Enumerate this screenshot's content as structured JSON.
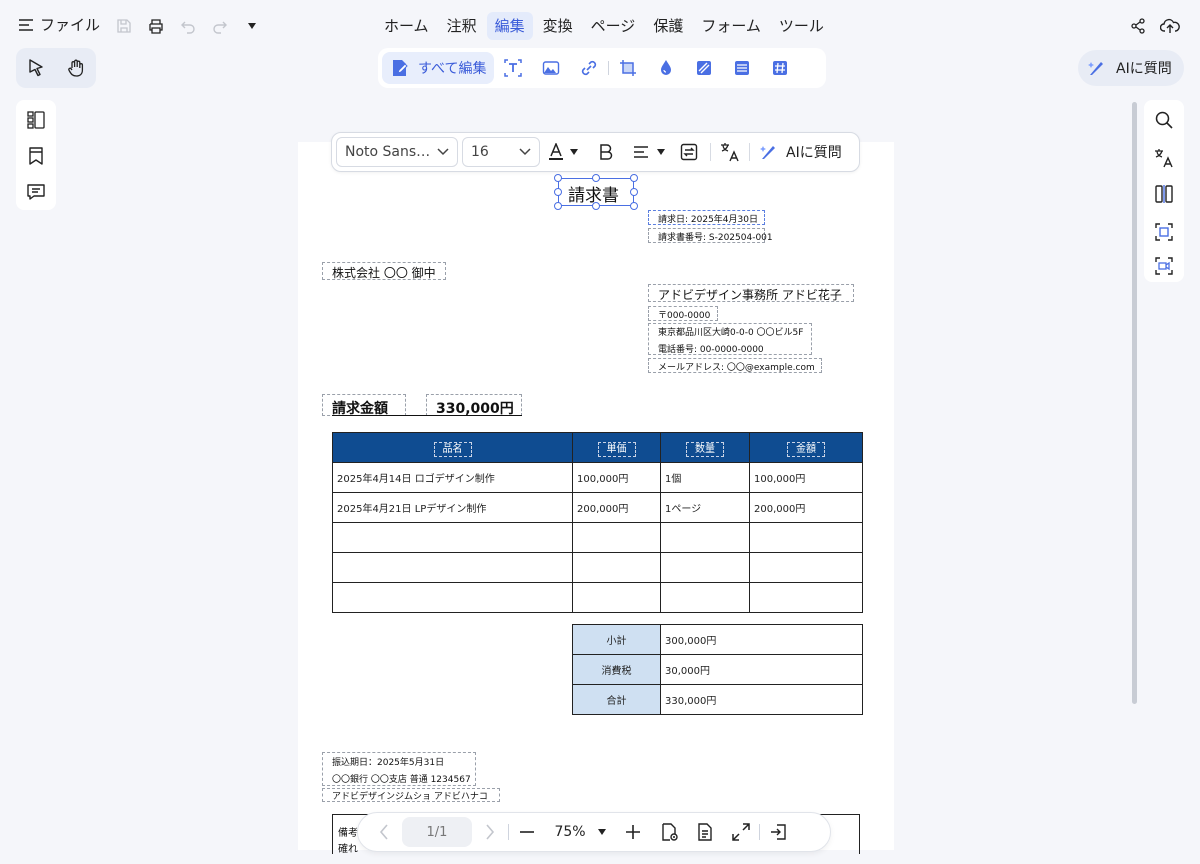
{
  "menu": {
    "file_label": "ファイル",
    "tabs": [
      "ホーム",
      "注釈",
      "編集",
      "変換",
      "ページ",
      "保護",
      "フォーム",
      "ツール"
    ],
    "active_tab": "編集"
  },
  "edit_toolbar": {
    "edit_all_label": "すべて編集"
  },
  "ai_button_label": "AIに質問",
  "text_toolbar": {
    "font_name": "Noto Sans…",
    "font_size": "16",
    "ai_label": "AIに質問"
  },
  "document": {
    "title": "請求書",
    "invoice_date": "請求日: 2025年4月30日",
    "invoice_number": "請求書番号: S-202504-001",
    "recipient": "株式会社 〇〇 御中",
    "sender": {
      "name": "アドビデザイン事務所 アドビ花子",
      "postal": "〒000-0000",
      "address": "東京都品川区大崎0-0-0 〇〇ビル5F",
      "phone": "電話番号: 00-0000-0000",
      "email": "メールアドレス: 〇〇@example.com"
    },
    "amount_label": "請求金額",
    "amount_value": "330,000円",
    "table": {
      "headers": [
        "品名",
        "単価",
        "数量",
        "金額"
      ],
      "rows": [
        [
          "2025年4月14日 ロゴデザイン制作",
          "100,000円",
          "1個",
          "100,000円"
        ],
        [
          "2025年4月21日 LPデザイン制作",
          "200,000円",
          "1ページ",
          "200,000円"
        ]
      ]
    },
    "summary": {
      "subtotal_label": "小計",
      "subtotal_value": "300,000円",
      "tax_label": "消費税",
      "tax_value": "30,000円",
      "total_label": "合計",
      "total_value": "330,000円"
    },
    "payment": {
      "due": "振込期日：2025年5月31日",
      "bank": "〇〇銀行 〇〇支店 普通 1234567",
      "holder": "アドビデザインジムショ アドビハナコ"
    },
    "remarks_label": "備考",
    "remarks_partial": "確れ"
  },
  "bottom_bar": {
    "page_indicator": "1/1",
    "zoom": "75%"
  },
  "colors": {
    "accent": "#3a5bd9",
    "table_header": "#0f4c91",
    "summary_label_bg": "#cfe0f2"
  }
}
